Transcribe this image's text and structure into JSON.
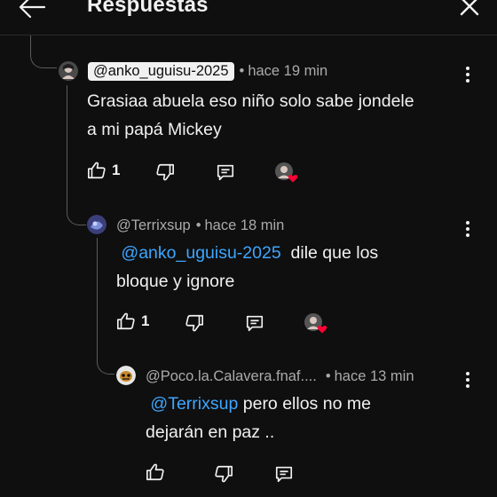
{
  "header": {
    "title": "Respuestas",
    "back_icon": "arrow-left-icon",
    "close_icon": "close-icon"
  },
  "comments": [
    {
      "author": "@anko_uguisu-2025",
      "author_highlighted": true,
      "time": "hace 19 min",
      "text_lines": [
        "Grasiaa abuela eso niño solo sabe jondele",
        "a mi papá Mickey"
      ],
      "like_count": "1"
    },
    {
      "author": "@Terrixsup",
      "time": "hace 18 min",
      "mention": "@anko_uguisu-2025",
      "text_after_mention": "dile que los",
      "text_line2": "bloque y ignore",
      "like_count": "1"
    },
    {
      "author": "@Poco.la.Calavera.fnaf....",
      "time": "hace 13 min",
      "mention": "@Terrixsup",
      "text_after_mention": "pero ellos no me",
      "text_line2": "dejarán en paz .."
    }
  ],
  "colors": {
    "background": "#0f0f0f",
    "text": "#f1f1f1",
    "meta": "#aaaaaa",
    "mention": "#3ea6ff",
    "heart": "#ff0033"
  }
}
